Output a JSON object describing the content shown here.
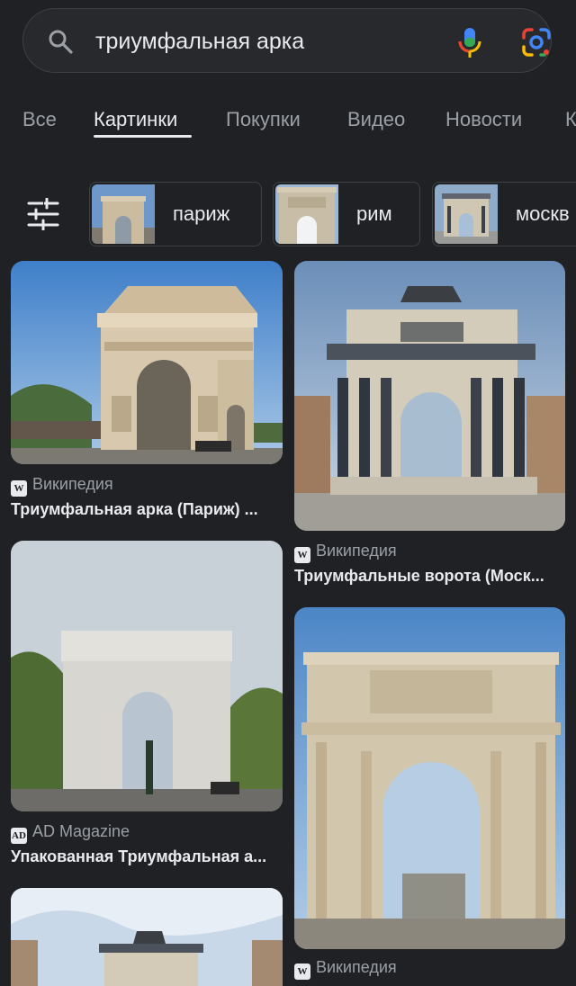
{
  "search": {
    "query": "триумфальная арка",
    "icons": [
      "search-icon",
      "microphone-icon",
      "google-lens-icon"
    ]
  },
  "tabs": [
    {
      "label": "Все",
      "active": false
    },
    {
      "label": "Картинки",
      "active": true
    },
    {
      "label": "Покупки",
      "active": false
    },
    {
      "label": "Видео",
      "active": false
    },
    {
      "label": "Новости",
      "active": false
    },
    {
      "label": "К",
      "active": false
    }
  ],
  "chips": [
    {
      "label": "париж"
    },
    {
      "label": "рим"
    },
    {
      "label": "москв"
    }
  ],
  "results": [
    {
      "source": "Википедия",
      "badge": "W",
      "title": "Триумфальная арка (Париж) ..."
    },
    {
      "source": "Википедия",
      "badge": "W",
      "title": "Триумфальные ворота (Моск..."
    },
    {
      "source": "AD Magazine",
      "badge": "AD",
      "title": "Упакованная Триумфальная а..."
    },
    {
      "source": "Википедия",
      "badge": "W",
      "title": ""
    },
    {
      "source": "",
      "badge": "",
      "title": ""
    }
  ],
  "colors": {
    "background": "#202124",
    "text": "#e8eaed",
    "muted": "#9aa0a6",
    "border": "#3c4043"
  }
}
